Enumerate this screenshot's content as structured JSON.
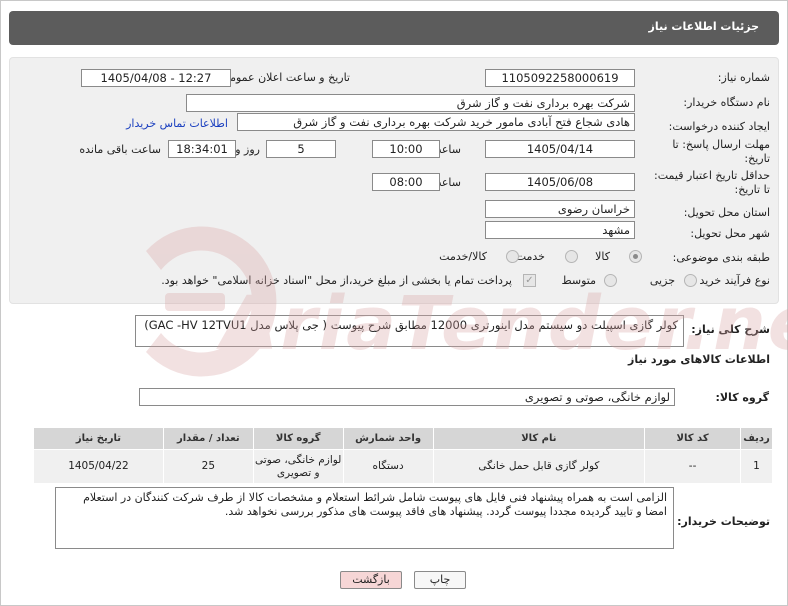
{
  "header": {
    "title": "جزئیات اطلاعات نیاز"
  },
  "form": {
    "need_number": {
      "label": "شماره نیاز:",
      "value": "1105092258000619"
    },
    "announce": {
      "label": "تاریخ و ساعت اعلان عمومی:",
      "value": "1405/04/08 - 12:27"
    },
    "buyer_org": {
      "label": "نام دستگاه خریدار:",
      "value": "شرکت بهره برداری نفت و گاز شرق"
    },
    "requester": {
      "label": "ایجاد کننده درخواست:",
      "value": "هادی شجاع فتح آبادی مامور خرید شرکت بهره برداری نفت و گاز شرق",
      "contact_link": "اطلاعات تماس خریدار"
    },
    "deadline": {
      "label1": "مهلت ارسال پاسخ: تا",
      "label2": "تاریخ:",
      "date": "1405/04/14",
      "time_label": "ساعت",
      "time": "10:00",
      "days": "5",
      "days_label": "روز و",
      "remaining": "18:34:01",
      "remaining_label": "ساعت باقی مانده"
    },
    "price_validity": {
      "label1": "حداقل تاریخ اعتبار قیمت:",
      "label2": "تا تاریخ:",
      "date": "1405/06/08",
      "time_label": "ساعت",
      "time": "08:00"
    },
    "province": {
      "label": "استان محل تحویل:",
      "value": "خراسان رضوی"
    },
    "city": {
      "label": "شهر محل تحویل:",
      "value": "مشهد"
    },
    "category": {
      "label": "طبقه بندی موضوعی:",
      "options": [
        "کالا",
        "خدمت",
        "کالا/خدمت"
      ],
      "selected": "کالا"
    },
    "process": {
      "label": "نوع فرآیند خرید :",
      "options": [
        "جزیی",
        "متوسط"
      ],
      "selected": "",
      "note": "پرداخت تمام یا بخشی از مبلغ خرید،از محل \"اسناد خزانه اسلامی\" خواهد بود."
    }
  },
  "description": {
    "label": "شرح کلی نیاز:",
    "value": "کولر گازی اسپیلت دو سیستم مدل اینورتری 12000 مطابق شرح پیوست ( جی پلاس مدل GAC -HV 12TVU1)"
  },
  "goods": {
    "section_title": "اطلاعات کالاهای مورد نیاز",
    "group_label": "گروه کالا:",
    "group_value": "لوازم خانگی، صوتی و تصویری",
    "columns": [
      "ردیف",
      "کد کالا",
      "نام کالا",
      "واحد شمارش",
      "گروه کالا",
      "تعداد / مقدار",
      "تاریخ نیاز"
    ],
    "rows": [
      {
        "row": "1",
        "code": "--",
        "name": "کولر گازی قابل حمل خانگی",
        "unit": "دستگاه",
        "group": "لوازم خانگی، صوتی و تصویری",
        "qty": "25",
        "date": "1405/04/22"
      }
    ]
  },
  "buyer_notes": {
    "label": "توضیحات خریدار:",
    "value": "الزامی است به همراه پیشنهاد فنی فایل های پیوست شامل شرائط استعلام و مشخصات کالا از طرف شرکت کنندگان در استعلام امضا و تایید گردیده مجددا پیوست گردد. پیشنهاد های فاقد پیوست های مذکور بررسی نخواهد شد."
  },
  "buttons": {
    "print": "چاپ",
    "back": "بازگشت"
  },
  "watermark": {
    "text": "AriaTender.net"
  },
  "colors": {
    "header_bg": "#5c5c5c",
    "panel_bg": "#f0f0f0",
    "link": "#1a3fbf",
    "back_button_bg": "#f6d6d6",
    "watermark": "#e6b3b3"
  }
}
